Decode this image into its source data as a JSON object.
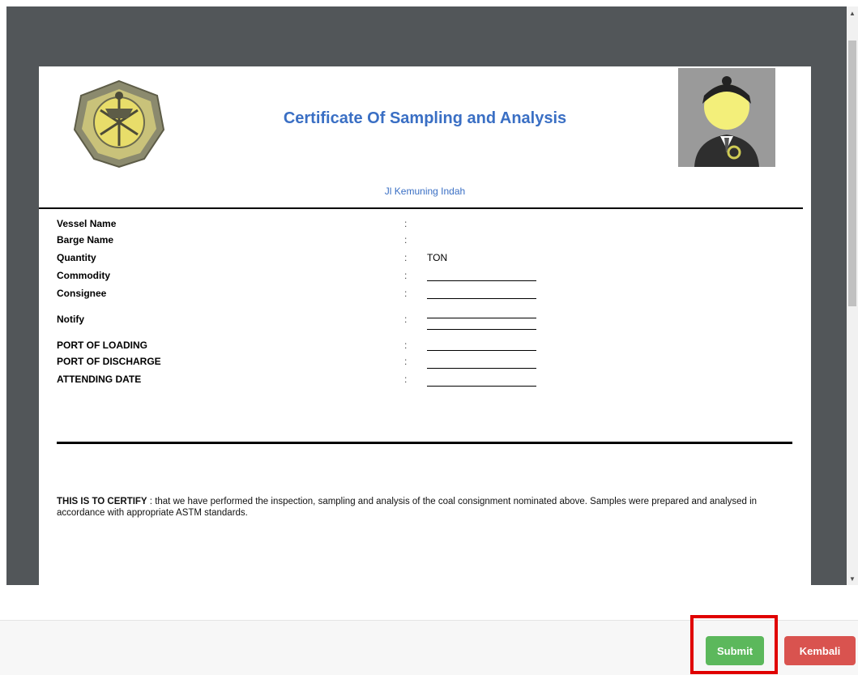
{
  "certificate": {
    "title": "Certificate Of Sampling and Analysis",
    "address": "Jl Kemuning Indah",
    "logo_icon": "esdm-emblem-icon",
    "avatar_icon": "user-avatar-icon"
  },
  "fields": [
    {
      "label": "Vessel Name",
      "colon": ":",
      "value": ""
    },
    {
      "label": "Barge Name",
      "colon": ":",
      "value": ""
    },
    {
      "label": "Quantity",
      "colon": ":",
      "value": "TON"
    },
    {
      "label": "Commodity",
      "colon": ":",
      "value": ""
    },
    {
      "label": "Consignee",
      "colon": ":",
      "value": ""
    },
    {
      "label": "Notify",
      "colon": ":",
      "value": ""
    },
    {
      "label": "PORT OF LOADING",
      "colon": ":",
      "value": ""
    },
    {
      "label": "PORT OF DISCHARGE",
      "colon": ":",
      "value": ""
    },
    {
      "label": "ATTENDING DATE",
      "colon": ":",
      "value": ""
    }
  ],
  "certify": {
    "lead": "THIS IS TO CERTIFY",
    "text": " : that we have performed the inspection, sampling and analysis of the coal consignment nominated above. Samples were prepared and analysed in accordance with appropriate ASTM standards."
  },
  "actions": {
    "submit_label": "Submit",
    "back_label": "Kembali"
  },
  "colors": {
    "submit": "#5cb85c",
    "back": "#d9534f",
    "title": "#3a6fc4",
    "highlight": "#e00000"
  }
}
